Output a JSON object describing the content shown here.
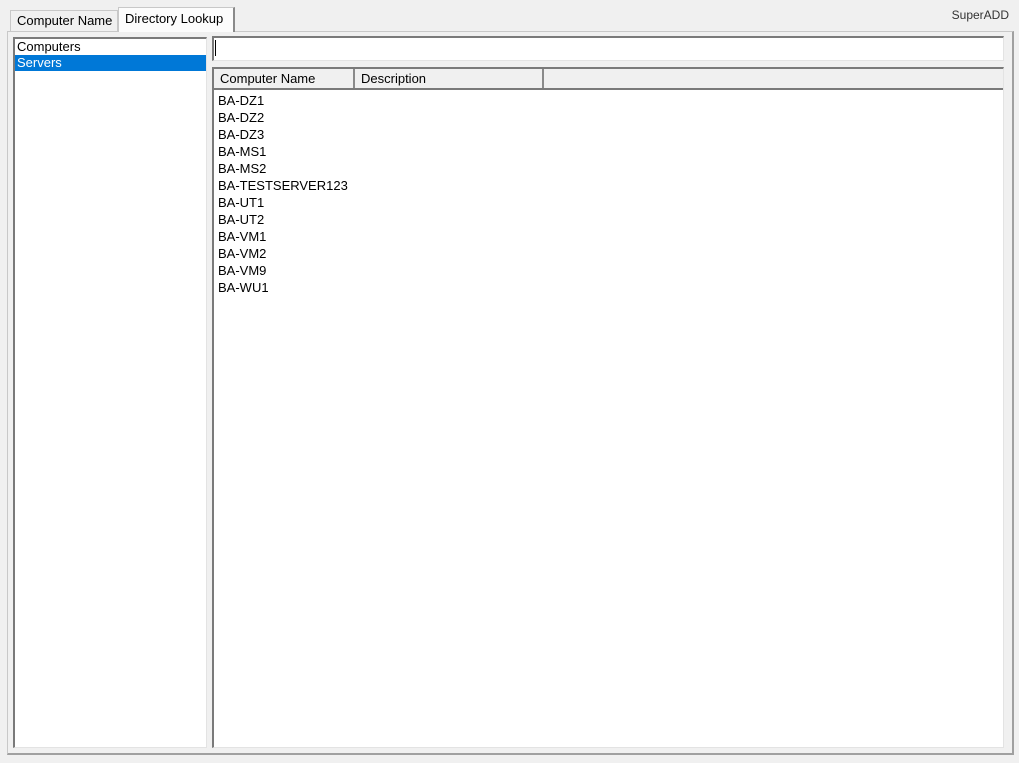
{
  "app": {
    "title": "SuperADD"
  },
  "tabs": [
    {
      "label": "Computer Name",
      "active": false
    },
    {
      "label": "Directory Lookup",
      "active": true
    }
  ],
  "sidebar": {
    "items": [
      {
        "label": "Computers",
        "selected": false
      },
      {
        "label": "Servers",
        "selected": true
      }
    ],
    "selection_color": "#0078d7"
  },
  "search": {
    "value": "",
    "placeholder": ""
  },
  "results": {
    "columns": [
      "Computer Name",
      "Description"
    ],
    "rows": [
      {
        "name": "BA-DZ1",
        "description": ""
      },
      {
        "name": "BA-DZ2",
        "description": ""
      },
      {
        "name": "BA-DZ3",
        "description": ""
      },
      {
        "name": "BA-MS1",
        "description": ""
      },
      {
        "name": "BA-MS2",
        "description": ""
      },
      {
        "name": "BA-TESTSERVER123",
        "description": ""
      },
      {
        "name": "BA-UT1",
        "description": ""
      },
      {
        "name": "BA-UT2",
        "description": ""
      },
      {
        "name": "BA-VM1",
        "description": ""
      },
      {
        "name": "BA-VM2",
        "description": ""
      },
      {
        "name": "BA-VM9",
        "description": ""
      },
      {
        "name": "BA-WU1",
        "description": ""
      }
    ]
  }
}
